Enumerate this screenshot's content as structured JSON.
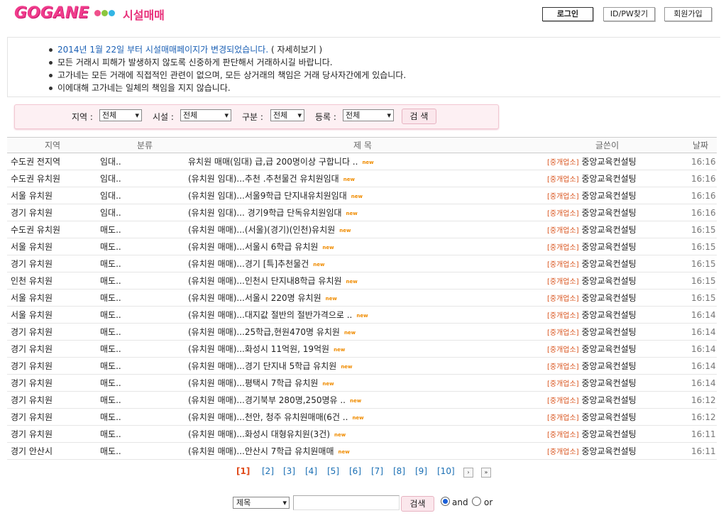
{
  "header": {
    "logo": "GOGANE",
    "section_title": "시설매매",
    "dot_colors": [
      "#f0508c",
      "#8cc63f",
      "#33b5e5"
    ],
    "login": "로그인",
    "find_idpw": "ID/PW찾기",
    "signup": "회원가입"
  },
  "notice": {
    "items": [
      {
        "text": "2014년 1월 22일 부터 시설매매페이지가 변경되었습니다.",
        "suffix": " ( 자세히보기 )"
      },
      {
        "text": "모든 거래시 피해가 발생하지 않도록 신중하게 판단해서 거래하시길 바랍니다.",
        "suffix": ""
      },
      {
        "text": "고가네는 모든 거래에 직접적인 관련이 없으며, 모든 상거래의 책임은 거래 당사자간에게 있습니다.",
        "suffix": ""
      },
      {
        "text": "이에대해 고가네는 일체의 책임을 지지 않습니다.",
        "suffix": ""
      }
    ]
  },
  "filter": {
    "region_label": "지역 :",
    "region_value": "전체",
    "facility_label": "시설 :",
    "facility_value": "전체",
    "category_label": "구분 :",
    "category_value": "전체",
    "reg_label": "등록 :",
    "reg_value": "전체",
    "search_button": "검 색"
  },
  "table": {
    "headers": {
      "region": "지역",
      "category": "분류",
      "title": "제  목",
      "author": "글쓴이",
      "date": "날짜"
    },
    "tag": "[중개업소]",
    "new_label": "new",
    "rows": [
      {
        "region": "수도권 전지역",
        "category": "임대..",
        "title": "유치원 매매(임대) 급,급 200명이상 구합니다 ..",
        "author": "중앙교육컨설팅",
        "date": "16:16"
      },
      {
        "region": "수도권 유치원",
        "category": "임대..",
        "title": "(유치원 임대)...추천 .추천물건 유치원임대",
        "author": "중앙교육컨설팅",
        "date": "16:16"
      },
      {
        "region": "서울 유치원",
        "category": "임대..",
        "title": "(유치원 임대)...서울9학급 단지내유치원임대",
        "author": "중앙교육컨설팅",
        "date": "16:16"
      },
      {
        "region": "경기 유치원",
        "category": "임대..",
        "title": "(유치원 임대)... 경기9학급 단독유치원임대",
        "author": "중앙교육컨설팅",
        "date": "16:16"
      },
      {
        "region": "수도권 유치원",
        "category": "매도..",
        "title": "(유치원 매매)...(서울)(경기)(인천)유치원",
        "author": "중앙교육컨설팅",
        "date": "16:15"
      },
      {
        "region": "서울 유치원",
        "category": "매도..",
        "title": "(유치원 매매)...서울시 6학급 유치원",
        "author": "중앙교육컨설팅",
        "date": "16:15"
      },
      {
        "region": "경기 유치원",
        "category": "매도..",
        "title": "(유치원 매매)...경기 [특]추천물건",
        "author": "중앙교육컨설팅",
        "date": "16:15"
      },
      {
        "region": "인천 유치원",
        "category": "매도..",
        "title": "(유치원 매매)...인천시 단지내8학급 유치원",
        "author": "중앙교육컨설팅",
        "date": "16:15"
      },
      {
        "region": "서울 유치원",
        "category": "매도..",
        "title": "(유치원 매매)...서울시 220명 유치원",
        "author": "중앙교육컨설팅",
        "date": "16:15"
      },
      {
        "region": "서울 유치원",
        "category": "매도..",
        "title": "(유치원 매매)...대지값 절반의 절반가격으로 ..",
        "author": "중앙교육컨설팅",
        "date": "16:14"
      },
      {
        "region": "경기 유치원",
        "category": "매도..",
        "title": "(유치원 매매)...25학급,현원470명 유치원",
        "author": "중앙교육컨설팅",
        "date": "16:14"
      },
      {
        "region": "경기 유치원",
        "category": "매도..",
        "title": "(유치원 매매)...화성시 11억원, 19억원",
        "author": "중앙교육컨설팅",
        "date": "16:14"
      },
      {
        "region": "경기 유치원",
        "category": "매도..",
        "title": "(유치원 매매)...경기 단지내 5학급 유치원",
        "author": "중앙교육컨설팅",
        "date": "16:14"
      },
      {
        "region": "경기 유치원",
        "category": "매도..",
        "title": "(유치원 매매)...평택시 7학급 유치원",
        "author": "중앙교육컨설팅",
        "date": "16:14"
      },
      {
        "region": "경기 유치원",
        "category": "매도..",
        "title": "(유치원 매매)...경기북부 280명,250명유 ..",
        "author": "중앙교육컨설팅",
        "date": "16:12"
      },
      {
        "region": "경기 유치원",
        "category": "매도..",
        "title": "(유치원 매매)...천안, 청주 유치원매매(6건 ..",
        "author": "중앙교육컨설팅",
        "date": "16:12"
      },
      {
        "region": "경기 유치원",
        "category": "매도..",
        "title": "(유치원 매매)...화성시 대형유치원(3건)",
        "author": "중앙교육컨설팅",
        "date": "16:11"
      },
      {
        "region": "경기 안산시",
        "category": "매도..",
        "title": "(유치원 매매)...안산시 7학급 유치원매매",
        "author": "중앙교육컨설팅",
        "date": "16:11"
      }
    ]
  },
  "pager": {
    "pages": [
      "[1]",
      "[2]",
      "[3]",
      "[4]",
      "[5]",
      "[6]",
      "[7]",
      "[8]",
      "[9]",
      "[10]"
    ],
    "current": 1,
    "next_icon": "›",
    "last_icon": "»"
  },
  "search": {
    "field_value": "제목",
    "input_value": "",
    "button": "검색",
    "and_label": "and",
    "or_label": "or",
    "selected": "and"
  }
}
